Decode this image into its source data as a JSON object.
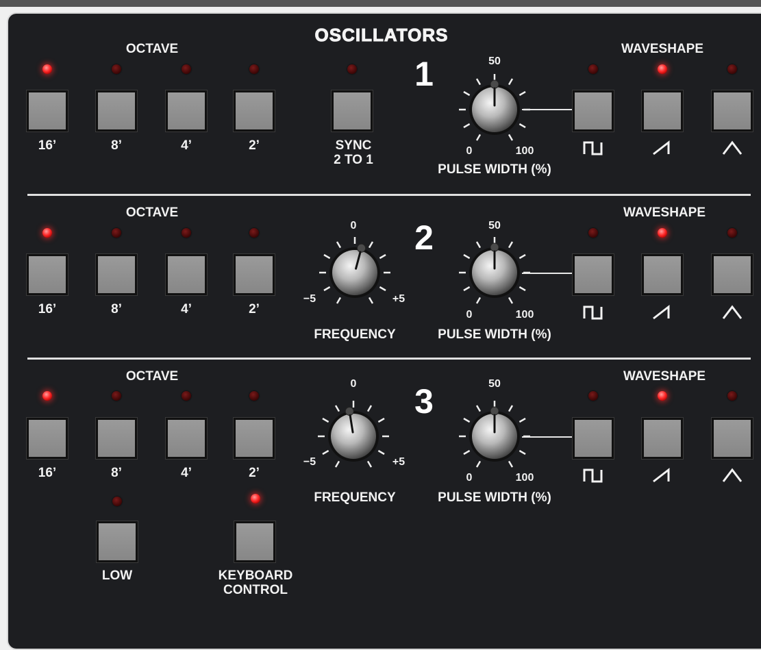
{
  "panel": {
    "title": "OSCILLATORS"
  },
  "oscillators": [
    {
      "number": "1",
      "octave_label": "OCTAVE",
      "octave_buttons": [
        {
          "label": "16’",
          "led_on": true
        },
        {
          "label": "8’",
          "led_on": false
        },
        {
          "label": "4’",
          "led_on": false
        },
        {
          "label": "2’",
          "led_on": false
        }
      ],
      "sync": {
        "label_line1": "SYNC",
        "label_line2": "2 TO 1",
        "led_on": false
      },
      "pulse_width": {
        "label": "PULSE WIDTH (%)",
        "min": "0",
        "mid": "50",
        "max": "100",
        "value_fraction": 0.5
      },
      "waveshape_label": "WAVESHAPE",
      "waveshapes": [
        {
          "icon": "square-wave-icon",
          "led_on": false
        },
        {
          "icon": "sawtooth-wave-icon",
          "led_on": true
        },
        {
          "icon": "triangle-wave-icon",
          "led_on": false
        }
      ]
    },
    {
      "number": "2",
      "octave_label": "OCTAVE",
      "octave_buttons": [
        {
          "label": "16’",
          "led_on": true
        },
        {
          "label": "8’",
          "led_on": false
        },
        {
          "label": "4’",
          "led_on": false
        },
        {
          "label": "2’",
          "led_on": false
        }
      ],
      "frequency": {
        "label": "FREQUENCY",
        "min": "−5",
        "mid": "0",
        "max": "+5",
        "value_fraction": 0.55
      },
      "pulse_width": {
        "label": "PULSE WIDTH (%)",
        "min": "0",
        "mid": "50",
        "max": "100",
        "value_fraction": 0.5
      },
      "waveshape_label": "WAVESHAPE",
      "waveshapes": [
        {
          "icon": "square-wave-icon",
          "led_on": false
        },
        {
          "icon": "sawtooth-wave-icon",
          "led_on": true
        },
        {
          "icon": "triangle-wave-icon",
          "led_on": false
        }
      ]
    },
    {
      "number": "3",
      "octave_label": "OCTAVE",
      "octave_buttons": [
        {
          "label": "16’",
          "led_on": true
        },
        {
          "label": "8’",
          "led_on": false
        },
        {
          "label": "4’",
          "led_on": false
        },
        {
          "label": "2’",
          "led_on": false
        }
      ],
      "frequency": {
        "label": "FREQUENCY",
        "min": "−5",
        "mid": "0",
        "max": "+5",
        "value_fraction": 0.47
      },
      "pulse_width": {
        "label": "PULSE WIDTH (%)",
        "min": "0",
        "mid": "50",
        "max": "100",
        "value_fraction": 0.5
      },
      "waveshape_label": "WAVESHAPE",
      "waveshapes": [
        {
          "icon": "square-wave-icon",
          "led_on": false
        },
        {
          "icon": "sawtooth-wave-icon",
          "led_on": true
        },
        {
          "icon": "triangle-wave-icon",
          "led_on": false
        }
      ],
      "low": {
        "label": "LOW",
        "led_on": false
      },
      "keyboard_control": {
        "label_line1": "KEYBOARD",
        "label_line2": "CONTROL",
        "led_on": true
      }
    }
  ]
}
